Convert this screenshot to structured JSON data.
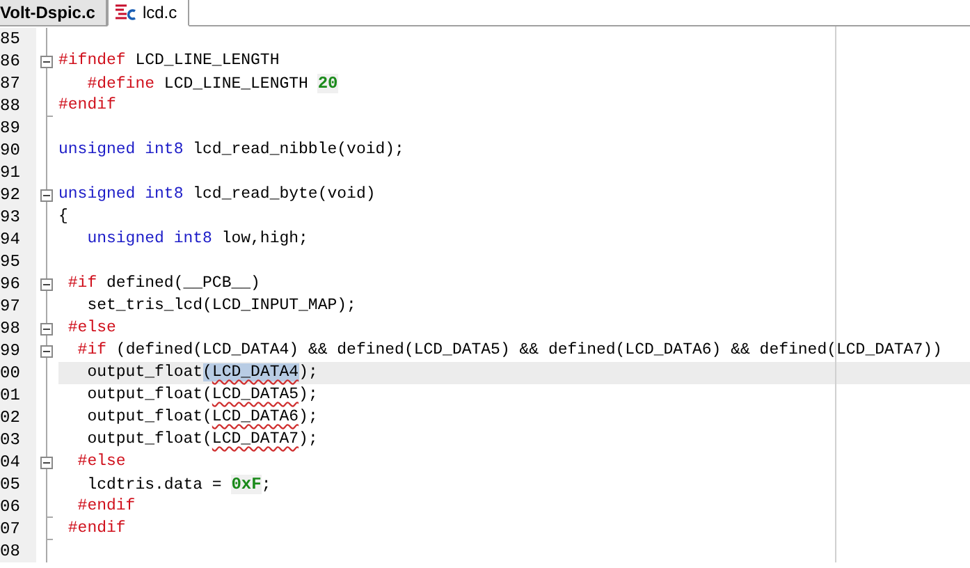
{
  "tabs": [
    {
      "label": "Volt-Dspic.c",
      "selected": false,
      "icon": false
    },
    {
      "label": "lcd.c",
      "selected": true,
      "icon": true
    }
  ],
  "lines": [
    {
      "number": "85",
      "kind": "plain",
      "current": false
    },
    {
      "number": "86",
      "kind": "fold-start",
      "current": false,
      "tokens": [
        {
          "text": "#ifndef",
          "kind": "directive"
        },
        {
          "text": " LCD_LINE_LENGTH",
          "kind": "plain"
        }
      ]
    },
    {
      "number": "87",
      "kind": "plain",
      "current": false,
      "tokens": [
        {
          "text": "   #define",
          "kind": "directive"
        },
        {
          "text": " LCD_LINE_LENGTH ",
          "kind": "plain"
        },
        {
          "text": "20",
          "kind": "number"
        }
      ]
    },
    {
      "number": "88",
      "kind": "fold-end",
      "current": false,
      "tokens": [
        {
          "text": "#endif",
          "kind": "directive"
        }
      ]
    },
    {
      "number": "89",
      "kind": "plain",
      "current": false
    },
    {
      "number": "90",
      "kind": "plain",
      "current": false,
      "tokens": [
        {
          "text": "unsigned int8",
          "kind": "keyword"
        },
        {
          "text": " lcd_read_nibble(void);",
          "kind": "plain"
        }
      ]
    },
    {
      "number": "91",
      "kind": "plain",
      "current": false
    },
    {
      "number": "92",
      "kind": "fold-start",
      "current": false,
      "tokens": [
        {
          "text": "unsigned int8",
          "kind": "keyword"
        },
        {
          "text": " lcd_read_byte(void)",
          "kind": "plain"
        }
      ]
    },
    {
      "number": "93",
      "kind": "plain",
      "current": false,
      "tokens": [
        {
          "text": "{",
          "kind": "plain"
        }
      ]
    },
    {
      "number": "94",
      "kind": "plain",
      "current": false,
      "tokens": [
        {
          "text": "   unsigned int8",
          "kind": "keyword"
        },
        {
          "text": " low,high;",
          "kind": "plain"
        }
      ]
    },
    {
      "number": "95",
      "kind": "plain",
      "current": false
    },
    {
      "number": "96",
      "kind": "fold-start",
      "current": false,
      "tokens": [
        {
          "text": " #if",
          "kind": "directive"
        },
        {
          "text": " defined(__PCB__)",
          "kind": "plain"
        }
      ]
    },
    {
      "number": "97",
      "kind": "plain",
      "current": false,
      "tokens": [
        {
          "text": "   set_tris_lcd(LCD_INPUT_MAP);",
          "kind": "plain"
        }
      ]
    },
    {
      "number": "98",
      "kind": "fold-start",
      "current": false,
      "tokens": [
        {
          "text": " #else",
          "kind": "directive"
        }
      ]
    },
    {
      "number": "99",
      "kind": "fold-start",
      "current": false,
      "tokens": [
        {
          "text": "  #if",
          "kind": "directive"
        },
        {
          "text": " (defined(LCD_DATA4) && defined(LCD_DATA5) && defined(LCD_DATA6) && defined(LCD_DATA7))",
          "kind": "plain"
        }
      ]
    },
    {
      "number": "00",
      "kind": "plain",
      "current": true,
      "tokens": [
        {
          "text": "   output_float",
          "kind": "plain"
        },
        {
          "text": "(",
          "kind": "match"
        },
        {
          "text": "LCD_DATA4",
          "kind": "match-squiggle"
        },
        {
          "text": ");",
          "kind": "plain"
        }
      ]
    },
    {
      "number": "01",
      "kind": "plain",
      "current": false,
      "tokens": [
        {
          "text": "   output_float(",
          "kind": "plain"
        },
        {
          "text": "LCD_DATA5",
          "kind": "squiggle"
        },
        {
          "text": ");",
          "kind": "plain"
        }
      ]
    },
    {
      "number": "02",
      "kind": "plain",
      "current": false,
      "tokens": [
        {
          "text": "   output_float(",
          "kind": "plain"
        },
        {
          "text": "LCD_DATA6",
          "kind": "squiggle"
        },
        {
          "text": ");",
          "kind": "plain"
        }
      ]
    },
    {
      "number": "03",
      "kind": "plain",
      "current": false,
      "tokens": [
        {
          "text": "   output_float(",
          "kind": "plain"
        },
        {
          "text": "LCD_DATA7",
          "kind": "squiggle"
        },
        {
          "text": ");",
          "kind": "plain"
        }
      ]
    },
    {
      "number": "04",
      "kind": "fold-start",
      "current": false,
      "tokens": [
        {
          "text": "  #else",
          "kind": "directive"
        }
      ]
    },
    {
      "number": "05",
      "kind": "plain",
      "current": false,
      "tokens": [
        {
          "text": "   lcdtris.data = ",
          "kind": "plain"
        },
        {
          "text": "0xF",
          "kind": "number"
        },
        {
          "text": ";",
          "kind": "plain"
        }
      ]
    },
    {
      "number": "06",
      "kind": "fold-end",
      "current": false,
      "tokens": [
        {
          "text": "  #endif",
          "kind": "directive"
        }
      ]
    },
    {
      "number": "07",
      "kind": "fold-end",
      "current": false,
      "tokens": [
        {
          "text": " #endif",
          "kind": "directive"
        }
      ]
    },
    {
      "number": "08",
      "kind": "plain",
      "current": false
    }
  ]
}
